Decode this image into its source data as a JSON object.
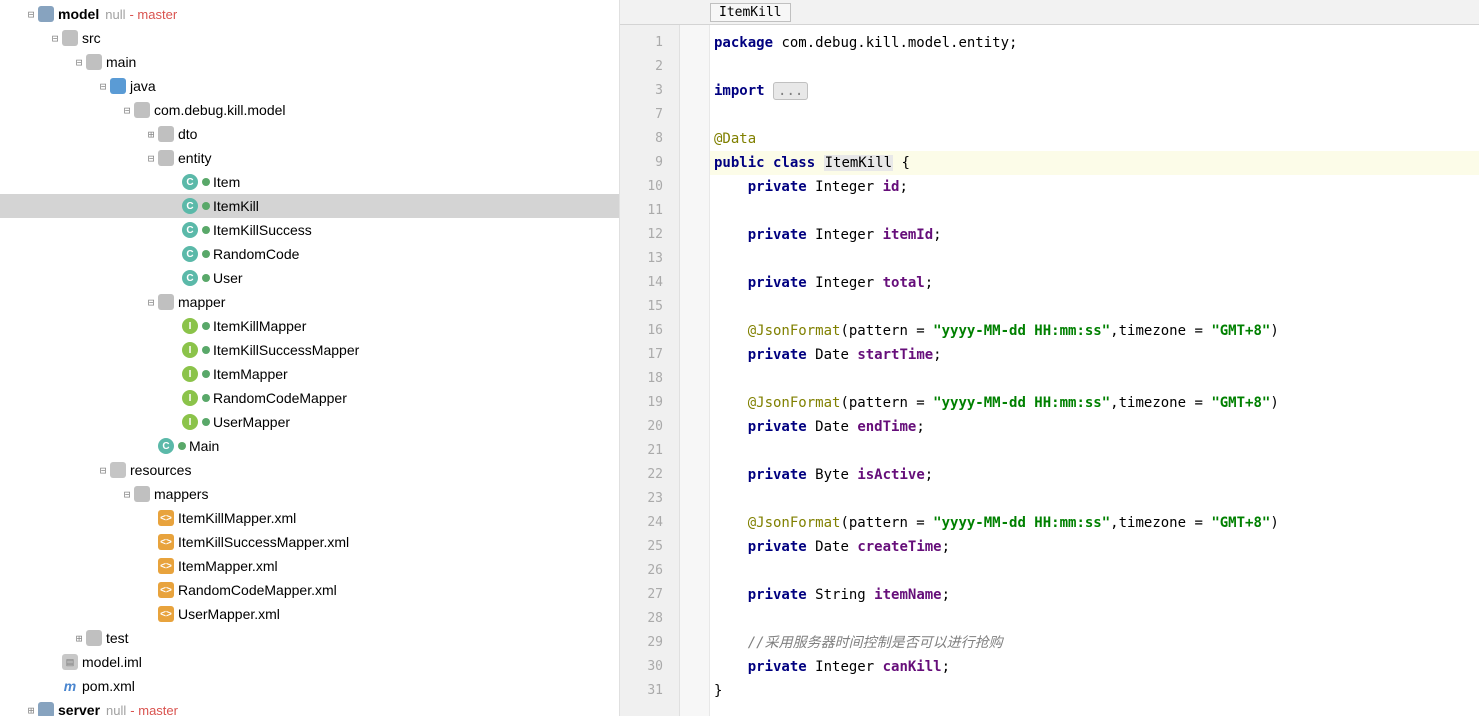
{
  "tree": {
    "model": {
      "name": "model",
      "meta": "null",
      "branch": "- master"
    },
    "src": "src",
    "main": "main",
    "java": "java",
    "package": "com.debug.kill.model",
    "dto": "dto",
    "entity": "entity",
    "classes_entity": [
      "Item",
      "ItemKill",
      "ItemKillSuccess",
      "RandomCode",
      "User"
    ],
    "mapper": "mapper",
    "classes_mapper": [
      "ItemKillMapper",
      "ItemKillSuccessMapper",
      "ItemMapper",
      "RandomCodeMapper",
      "UserMapper"
    ],
    "main_class": "Main",
    "resources": "resources",
    "mappers": "mappers",
    "xml_files": [
      "ItemKillMapper.xml",
      "ItemKillSuccessMapper.xml",
      "ItemMapper.xml",
      "RandomCodeMapper.xml",
      "UserMapper.xml"
    ],
    "test": "test",
    "iml": "model.iml",
    "pom": "pom.xml",
    "server": {
      "name": "server",
      "meta": "null",
      "branch": "- master"
    }
  },
  "breadcrumb": {
    "item": "ItemKill"
  },
  "gutter_lines": [
    "1",
    "2",
    "3",
    "7",
    "8",
    "9",
    "10",
    "11",
    "12",
    "13",
    "14",
    "15",
    "16",
    "17",
    "18",
    "19",
    "20",
    "21",
    "22",
    "23",
    "24",
    "25",
    "26",
    "27",
    "28",
    "29",
    "30",
    "31"
  ],
  "code": {
    "l1": {
      "kw1": "package",
      "pkg": " com.debug.kill.model.entity;"
    },
    "l3": {
      "kw": "import",
      "fold": "..."
    },
    "l8": {
      "ann": "@Data"
    },
    "l9": {
      "kw1": "public class",
      "cls": "ItemKill",
      "brace": " {"
    },
    "l10": {
      "kw": "private",
      "type": " Integer ",
      "fld": "id",
      "semi": ";"
    },
    "l12": {
      "kw": "private",
      "type": " Integer ",
      "fld": "itemId",
      "semi": ";"
    },
    "l14": {
      "kw": "private",
      "type": " Integer ",
      "fld": "total",
      "semi": ";"
    },
    "l16": {
      "ann": "@JsonFormat",
      "paren": "(pattern = ",
      "str1": "\"yyyy-MM-dd HH:mm:ss\"",
      "mid": ",timezone = ",
      "str2": "\"GMT+8\"",
      "close": ")"
    },
    "l17": {
      "kw": "private",
      "type": " Date ",
      "fld": "startTime",
      "semi": ";"
    },
    "l19": {
      "ann": "@JsonFormat",
      "paren": "(pattern = ",
      "str1": "\"yyyy-MM-dd HH:mm:ss\"",
      "mid": ",timezone = ",
      "str2": "\"GMT+8\"",
      "close": ")"
    },
    "l20": {
      "kw": "private",
      "type": " Date ",
      "fld": "endTime",
      "semi": ";"
    },
    "l22": {
      "kw": "private",
      "type": " Byte ",
      "fld": "isActive",
      "semi": ";"
    },
    "l24": {
      "ann": "@JsonFormat",
      "paren": "(pattern = ",
      "str1": "\"yyyy-MM-dd HH:mm:ss\"",
      "mid": ",timezone = ",
      "str2": "\"GMT+8\"",
      "close": ")"
    },
    "l25": {
      "kw": "private",
      "type": " Date ",
      "fld": "createTime",
      "semi": ";"
    },
    "l27": {
      "kw": "private",
      "type": " String ",
      "fld": "itemName",
      "semi": ";"
    },
    "l29": {
      "cmt": "//采用服务器时间控制是否可以进行抢购"
    },
    "l30": {
      "kw": "private",
      "type": " Integer ",
      "fld": "canKill",
      "semi": ";"
    },
    "l31": {
      "brace": "}"
    }
  }
}
